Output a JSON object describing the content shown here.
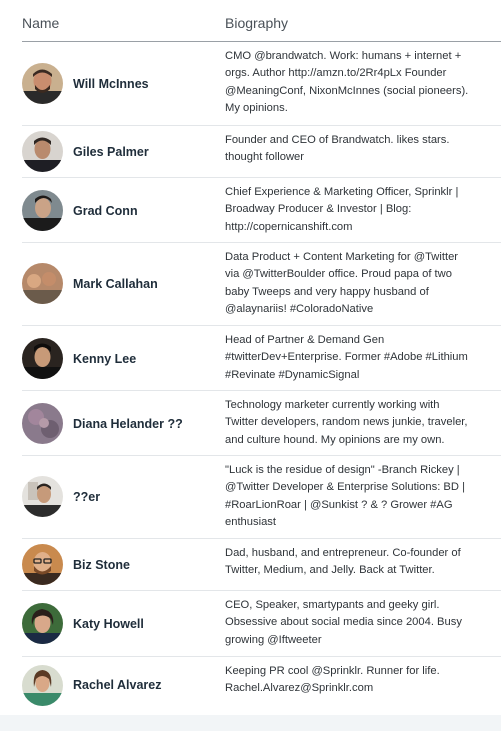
{
  "header": {
    "name_label": "Name",
    "bio_label": "Biography"
  },
  "rows": [
    {
      "name": "Will McInnes",
      "bio": [
        "CMO @brandwatch. Work: humans + internet +",
        "orgs. Author http://amzn.to/2Rr4pLx Founder",
        "@MeaningConf, NixonMcInnes (social pioneers).",
        "My opinions."
      ]
    },
    {
      "name": "Giles Palmer",
      "bio": [
        "Founder and CEO of Brandwatch. likes stars.",
        "thought follower"
      ]
    },
    {
      "name": "Grad Conn",
      "bio": [
        "Chief Experience & Marketing Officer, Sprinklr |",
        "Broadway Producer & Investor | Blog:",
        "http://copernicanshift.com"
      ]
    },
    {
      "name": "Mark Callahan",
      "bio": [
        "Data Product + Content Marketing for @Twitter",
        "via @TwitterBoulder office. Proud papa of two",
        "baby Tweeps and very happy husband of",
        "@alaynariis! #ColoradoNative"
      ]
    },
    {
      "name": "Kenny Lee",
      "bio": [
        "Head of Partner & Demand Gen",
        "#twitterDev+Enterprise. Former #Adobe #Lithium",
        "#Revinate #DynamicSignal"
      ]
    },
    {
      "name": "Diana Helander ??",
      "bio": [
        "Technology marketer currently working with",
        "Twitter developers, random news junkie, traveler,",
        "and culture hound. My opinions are my own."
      ]
    },
    {
      "name": "??er",
      "bio": [
        "\"Luck is the residue of design\" -Branch Rickey |",
        "@Twitter Developer & Enterprise Solutions: BD |",
        "#RoarLionRoar | @Sunkist ? & ? Grower #AG",
        "enthusiast"
      ]
    },
    {
      "name": "Biz Stone",
      "bio": [
        "Dad, husband, and entrepreneur. Co-founder of",
        "Twitter, Medium, and Jelly. Back at Twitter."
      ]
    },
    {
      "name": "Katy Howell",
      "bio": [
        "CEO, Speaker, smartypants and geeky girl.",
        "Obsessive about social media since 2004. Busy",
        "growing @Iftweeter"
      ]
    },
    {
      "name": "Rachel Alvarez",
      "bio": [
        "Keeping PR cool @Sprinklr. Runner for life.",
        "Rachel.Alvarez@Sprinklr.com"
      ]
    }
  ]
}
